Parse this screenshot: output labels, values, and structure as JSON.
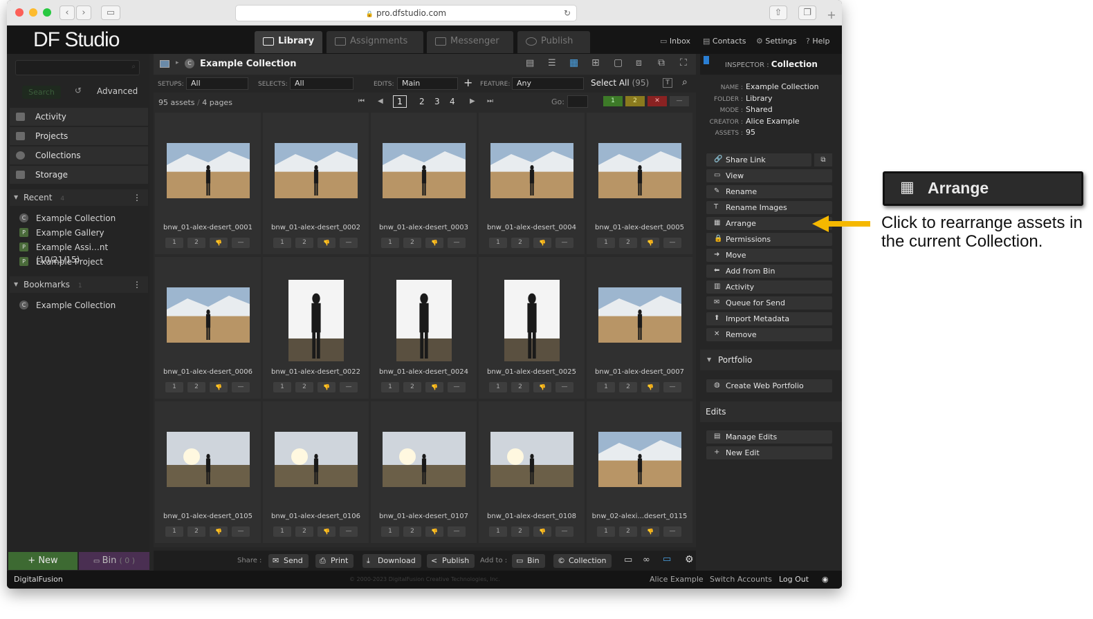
{
  "browser": {
    "url": "pro.dfstudio.com"
  },
  "app": {
    "logo": "DF Studio"
  },
  "tabs": [
    {
      "label": "Library"
    },
    {
      "label": "Assignments"
    },
    {
      "label": "Messenger"
    },
    {
      "label": "Publish"
    }
  ],
  "toplinks": {
    "inbox": "Inbox",
    "contacts": "Contacts",
    "settings": "Settings",
    "help": "Help"
  },
  "left": {
    "search_button": "Search",
    "advanced": "Advanced",
    "nav": [
      "Activity",
      "Projects",
      "Collections",
      "Storage"
    ],
    "recent": {
      "label": "Recent",
      "count": "4",
      "items": [
        {
          "badge": "C",
          "label": "Example Collection"
        },
        {
          "badge": "P",
          "label": "Example Gallery"
        },
        {
          "badge": "P",
          "label": "Example Assi…nt (10/21/15)"
        },
        {
          "badge": "P",
          "label": "Example Project"
        }
      ]
    },
    "bookmarks": {
      "label": "Bookmarks",
      "count": "1",
      "items": [
        {
          "badge": "C",
          "label": "Example Collection"
        }
      ]
    },
    "new_button": "New",
    "bin_button": "Bin",
    "bin_count": "( 0 )"
  },
  "center": {
    "title": "Example Collection",
    "filters": {
      "setups_label": "SETUPS:",
      "setups": "All",
      "selects_label": "SELECTS:",
      "selects": "All",
      "edits_label": "EDITS:",
      "edits": "Main",
      "feature_label": "FEATURE:",
      "feature": "Any",
      "select_all": "Select All",
      "select_all_count": "(95)"
    },
    "pager": {
      "assets": "95 assets",
      "pages": "4 pages",
      "pages_list": [
        "1",
        "2",
        "3",
        "4"
      ],
      "current": "1",
      "go_label": "Go:"
    },
    "ratings": [
      "1",
      "2",
      "",
      "—"
    ],
    "assets": [
      {
        "name": "bnw_01-alex-desert_0001",
        "orient": "landscape",
        "scene": "day"
      },
      {
        "name": "bnw_01-alex-desert_0002",
        "orient": "landscape",
        "scene": "day"
      },
      {
        "name": "bnw_01-alex-desert_0003",
        "orient": "landscape",
        "scene": "day"
      },
      {
        "name": "bnw_01-alex-desert_0004",
        "orient": "landscape",
        "scene": "day"
      },
      {
        "name": "bnw_01-alex-desert_0005",
        "orient": "landscape",
        "scene": "day"
      },
      {
        "name": "bnw_01-alex-desert_0006",
        "orient": "landscape",
        "scene": "day"
      },
      {
        "name": "bnw_01-alex-desert_0022",
        "orient": "portrait",
        "scene": "bright"
      },
      {
        "name": "bnw_01-alex-desert_0024",
        "orient": "portrait",
        "scene": "bright"
      },
      {
        "name": "bnw_01-alex-desert_0025",
        "orient": "portrait",
        "scene": "bright"
      },
      {
        "name": "bnw_01-alex-desert_0007",
        "orient": "landscape",
        "scene": "day"
      },
      {
        "name": "bnw_01-alex-desert_0105",
        "orient": "landscape",
        "scene": "sunset"
      },
      {
        "name": "bnw_01-alex-desert_0106",
        "orient": "landscape",
        "scene": "sunset"
      },
      {
        "name": "bnw_01-alex-desert_0107",
        "orient": "landscape",
        "scene": "sunset"
      },
      {
        "name": "bnw_01-alex-desert_0108",
        "orient": "landscape",
        "scene": "sunset"
      },
      {
        "name": "bnw_02-alexi...desert_0115",
        "orient": "landscape",
        "scene": "day"
      }
    ],
    "bottom": {
      "share_label": "Share :",
      "send": "Send",
      "print": "Print",
      "download": "Download",
      "publish": "Publish",
      "addto_label": "Add to :",
      "bin": "Bin",
      "collection": "Collection"
    }
  },
  "inspector": {
    "label": "INSPECTOR :",
    "type": "Collection",
    "meta": [
      {
        "k": "NAME :",
        "v": "Example Collection"
      },
      {
        "k": "FOLDER :",
        "v": "Library"
      },
      {
        "k": "MODE :",
        "v": "Shared"
      },
      {
        "k": "CREATOR :",
        "v": "Alice Example"
      },
      {
        "k": "ASSETS :",
        "v": "95"
      }
    ],
    "actions": [
      "Share Link",
      "View",
      "Rename",
      "Rename Images",
      "Arrange",
      "Permissions",
      "Move",
      "Add from Bin",
      "Activity",
      "Queue for Send",
      "Import Metadata",
      "Remove"
    ],
    "portfolio_label": "Portfolio",
    "create_web_portfolio": "Create Web Portfolio",
    "edits_label": "Edits",
    "manage_edits": "Manage Edits",
    "new_edit": "New Edit"
  },
  "footer": {
    "brand": "DigitalFusion",
    "copyright": "© 2000-2023 DigitalFusion Creative Technologies, Inc.",
    "user": "Alice Example",
    "switch": "Switch Accounts",
    "logout": "Log Out"
  },
  "callout": {
    "title": "Arrange",
    "text": "Click to rearrange assets in the current Collection."
  },
  "colors": {
    "arrow": "#f5b800",
    "rating_green": "#3d7a28",
    "rating_yellow": "#8a7a1e",
    "rating_red": "#8a2222"
  }
}
